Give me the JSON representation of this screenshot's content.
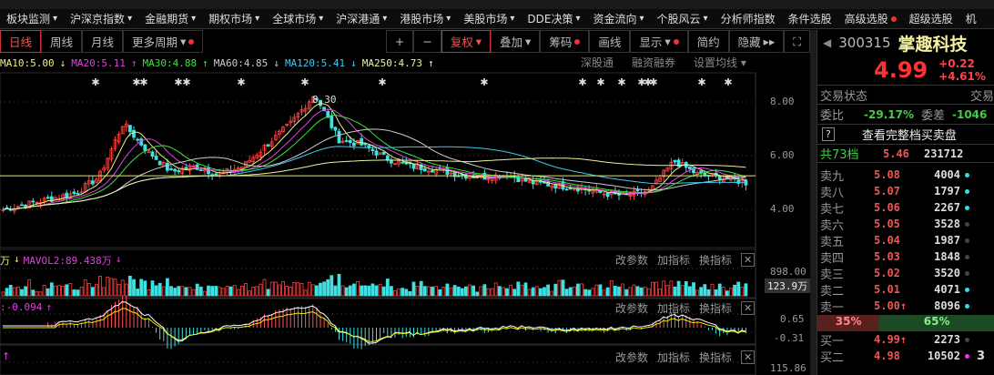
{
  "menu": [
    {
      "label": "板块监测",
      "dd": true
    },
    {
      "label": "沪深京指数",
      "dd": true
    },
    {
      "label": "金融期货",
      "dd": true
    },
    {
      "label": "期权市场",
      "dd": true
    },
    {
      "label": "全球市场",
      "dd": true
    },
    {
      "label": "沪深港通",
      "dd": true
    },
    {
      "label": "港股市场",
      "dd": true
    },
    {
      "label": "美股市场",
      "dd": true
    },
    {
      "label": "DDE决策",
      "dd": true
    },
    {
      "label": "资金流向",
      "dd": true
    },
    {
      "label": "个股风云",
      "dd": true
    },
    {
      "label": "分析师指数",
      "dd": false
    },
    {
      "label": "条件选股",
      "dd": false
    },
    {
      "label": "高级选股",
      "dd": false,
      "dot": true
    },
    {
      "label": "超级选股",
      "dd": false
    },
    {
      "label": "机",
      "dd": false
    }
  ],
  "toolbar": {
    "periods": [
      "日线",
      "周线",
      "月线",
      "更多周期"
    ],
    "zoom_in": "+",
    "zoom_out": "−",
    "tools": [
      "复权",
      "叠加",
      "筹码",
      "画线",
      "显示",
      "简约",
      "隐藏"
    ],
    "hide_arrows": "▸▸",
    "fullscreen": "⛶"
  },
  "ma": [
    {
      "text": "MA10:5.00",
      "arrow": "↓",
      "color": "#f0f080"
    },
    {
      "text": "MA20:5.11",
      "arrow": "↑",
      "color": "#e040e0"
    },
    {
      "text": "MA30:4.88",
      "arrow": "↑",
      "color": "#40e040"
    },
    {
      "text": "MA60:4.85",
      "arrow": "↓",
      "color": "#ccc"
    },
    {
      "text": "MA120:5.41",
      "arrow": "↓",
      "color": "#40c8f0"
    },
    {
      "text": "MA250:4.73",
      "arrow": "↑",
      "color": "#f0f0a0"
    }
  ],
  "chart_links": [
    "深股通",
    "融资融券",
    "设置均线 ▾"
  ],
  "price_axis": [
    "8.00",
    "6.00",
    "4.00"
  ],
  "high_marker": "8.30",
  "price_anchors": [
    4.0,
    4.2,
    4.4,
    4.6,
    5.2,
    7.2,
    6.2,
    5.4,
    5.6,
    5.3,
    5.6,
    6.4,
    7.2,
    8.3,
    6.6,
    6.4,
    5.9,
    5.6,
    5.5,
    5.3,
    5.2,
    5.3,
    5.0,
    4.9,
    4.8,
    4.6,
    4.5,
    4.7,
    5.8,
    5.3,
    5.2,
    4.99
  ],
  "volume": {
    "label": "MAVOL2:89.438万",
    "arrow": "↓",
    "prefix": "万",
    "arrow0": "↓",
    "axis_top": "898.00",
    "current": "123.9万"
  },
  "macd": {
    "label": ":-0.094",
    "arrow": "↑",
    "axis_top": "0.65",
    "axis_bottom": "-0.31"
  },
  "third": {
    "arrow": "↑",
    "axis_top": "115.86"
  },
  "panel_actions": [
    "改参数",
    "加指标",
    "换指标"
  ],
  "panel_close": "✕",
  "stock": {
    "code": "300315",
    "name": "掌趣科技",
    "price": "4.99",
    "change": "+0.22",
    "pct": "+4.61%"
  },
  "status": {
    "label": "交易状态",
    "value": "交易"
  },
  "weibi": {
    "label": "委比",
    "value": "-29.17%",
    "diff_label": "委差",
    "diff_value": "-1046"
  },
  "full_book": {
    "help": "?",
    "label": "查看完整档买卖盘"
  },
  "total": {
    "label": "共73档",
    "price": "5.46",
    "vol": "231712"
  },
  "asks": [
    {
      "l": "卖九",
      "p": "5.08",
      "v": "4004",
      "d": "#3de"
    },
    {
      "l": "卖八",
      "p": "5.07",
      "v": "1797",
      "d": "#3de"
    },
    {
      "l": "卖七",
      "p": "5.06",
      "v": "2267",
      "d": "#3de"
    },
    {
      "l": "卖六",
      "p": "5.05",
      "v": "3528",
      "d": "#444"
    },
    {
      "l": "卖五",
      "p": "5.04",
      "v": "1987",
      "d": "#444"
    },
    {
      "l": "卖四",
      "p": "5.03",
      "v": "1848",
      "d": "#444"
    },
    {
      "l": "卖三",
      "p": "5.02",
      "v": "3520",
      "d": "#444"
    },
    {
      "l": "卖二",
      "p": "5.01",
      "v": "4071",
      "d": "#3de"
    },
    {
      "l": "卖一",
      "p": "5.00↑",
      "v": "8096",
      "d": "#3de"
    }
  ],
  "ratio": {
    "sell": "35%",
    "buy": "65%",
    "sell_pct": 35
  },
  "bids": [
    {
      "l": "买一",
      "p": "4.99↑",
      "v": "2273",
      "d": "#444",
      "x": ""
    },
    {
      "l": "买二",
      "p": "4.98",
      "v": "10502",
      "d": "#e3e",
      "x": "3"
    }
  ]
}
